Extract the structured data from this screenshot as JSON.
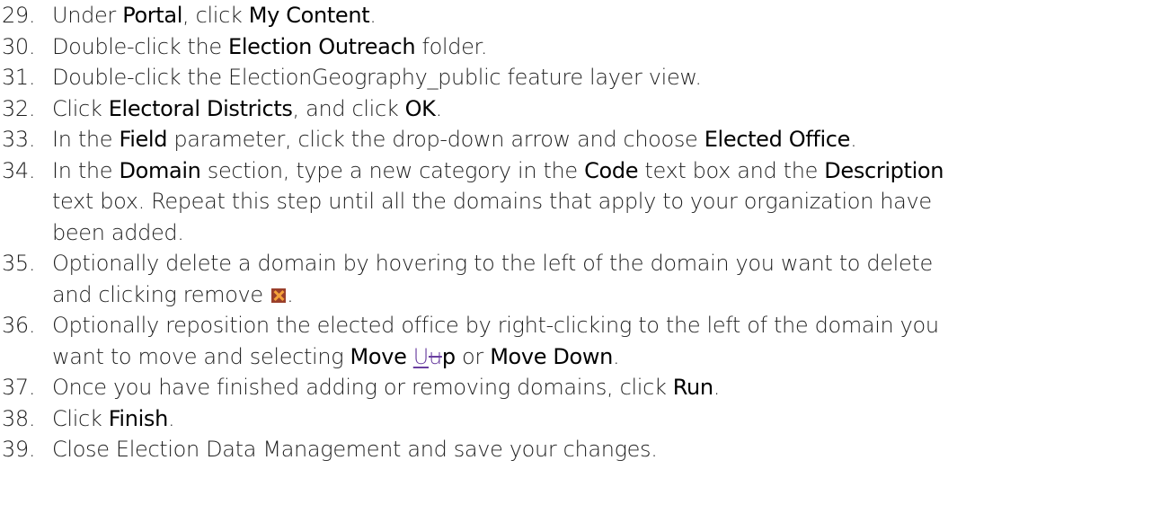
{
  "steps": [
    {
      "number": "29.",
      "parts": [
        {
          "t": "Under "
        },
        {
          "b": "Portal"
        },
        {
          "t": ", click "
        },
        {
          "b": "My Content"
        },
        {
          "t": "."
        }
      ]
    },
    {
      "number": "30.",
      "parts": [
        {
          "t": "Double-click the "
        },
        {
          "b": "Election Outreach"
        },
        {
          "t": " folder."
        }
      ]
    },
    {
      "number": "31.",
      "parts": [
        {
          "t": "Double-click the ElectionGeography_public feature layer view."
        }
      ]
    },
    {
      "number": "32.",
      "parts": [
        {
          "t": "Click "
        },
        {
          "b": "Electoral Districts"
        },
        {
          "t": ", and click "
        },
        {
          "b": "OK"
        },
        {
          "t": "."
        }
      ]
    },
    {
      "number": "33.",
      "parts": [
        {
          "t": "In the "
        },
        {
          "b": "Field"
        },
        {
          "t": " parameter, click the drop-down arrow and choose "
        },
        {
          "b": "Elected Office"
        },
        {
          "t": "."
        }
      ]
    },
    {
      "number": "34.",
      "parts": [
        {
          "t": "In the "
        },
        {
          "b": "Domain"
        },
        {
          "t": " section, type a new category in the "
        },
        {
          "b": "Code"
        },
        {
          "t": " text box and the "
        },
        {
          "b": "Description"
        },
        {
          "br": true
        },
        {
          "t": "text box. Repeat this step until all the domains that apply to your organization have"
        },
        {
          "br": true
        },
        {
          "t": "been added."
        }
      ]
    },
    {
      "number": "35.",
      "parts": [
        {
          "t": "Optionally delete a domain by hovering to the left of the domain you want to delete"
        },
        {
          "br": true
        },
        {
          "t": "and clicking remove "
        },
        {
          "icon": "remove-icon"
        },
        {
          "t": "."
        }
      ]
    },
    {
      "number": "36.",
      "parts": [
        {
          "t": "Optionally reposition the elected office by right-clicking to the left of the domain you"
        },
        {
          "br": true
        },
        {
          "t": "want to move and selecting "
        },
        {
          "b": "Move "
        },
        {
          "ins": "U"
        },
        {
          "del": "u"
        },
        {
          "b": "p"
        },
        {
          "t": " or "
        },
        {
          "b": "Move Down"
        },
        {
          "t": "."
        }
      ]
    },
    {
      "number": "37.",
      "parts": [
        {
          "t": "Once you have finished adding or removing domains, click "
        },
        {
          "b": "Run"
        },
        {
          "t": "."
        }
      ]
    },
    {
      "number": "38.",
      "parts": [
        {
          "t": "Click "
        },
        {
          "b": "Finish"
        },
        {
          "t": "."
        }
      ]
    },
    {
      "number": "39.",
      "parts": [
        {
          "t": "Close Election Data Management and save your changes."
        }
      ]
    }
  ],
  "colors": {
    "text": "#1f1f1f",
    "emphasis": "#000000",
    "revision_mark": "#6a3fa0",
    "remove_icon_bg": "#9a3f2b",
    "remove_icon_x": "#f4a23a"
  }
}
